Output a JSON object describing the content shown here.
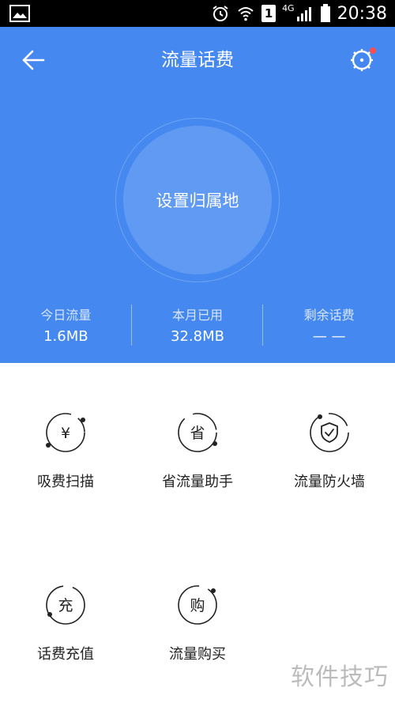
{
  "status_bar": {
    "network_type": "4G",
    "sim_slot": "1",
    "time": "20:38"
  },
  "header": {
    "title": "流量话费",
    "back_icon": "arrow-left-icon",
    "settings_icon": "settings-gear-icon",
    "has_notification_dot": true
  },
  "hero": {
    "circle_label": "设置归属地"
  },
  "stats": [
    {
      "label": "今日流量",
      "value": "1.6MB"
    },
    {
      "label": "本月已用",
      "value": "32.8MB"
    },
    {
      "label": "剩余话费",
      "value": "— —"
    }
  ],
  "features": [
    {
      "label": "吸费扫描",
      "icon_glyph": "¥",
      "icon": "yuan-scan-icon"
    },
    {
      "label": "省流量助手",
      "icon_glyph": "省",
      "icon": "save-data-icon"
    },
    {
      "label": "流量防火墙",
      "icon_glyph": "",
      "icon": "shield-check-icon"
    },
    {
      "label": "话费充值",
      "icon_glyph": "充",
      "icon": "recharge-icon"
    },
    {
      "label": "流量购买",
      "icon_glyph": "购",
      "icon": "buy-data-icon"
    }
  ],
  "watermark": "软件技巧",
  "colors": {
    "primary": "#4589f0",
    "notification": "#ff4d4d"
  }
}
